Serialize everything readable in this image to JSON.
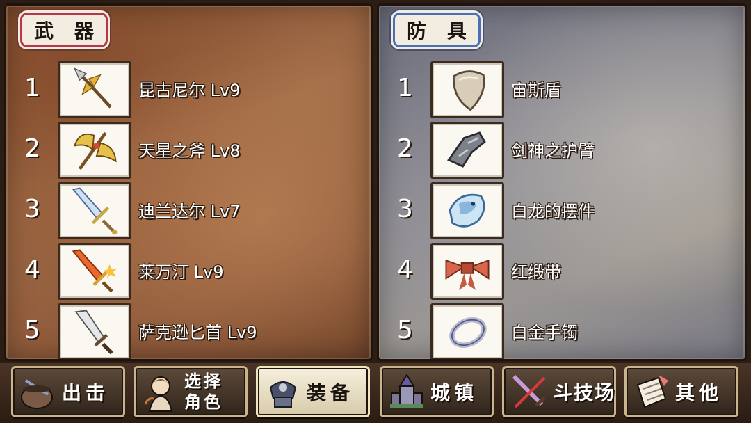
{
  "weapons_panel": {
    "title": "武 器",
    "items": [
      {
        "num": "1",
        "name": "昆古尼尔 Lv9",
        "icon": "spear-icon"
      },
      {
        "num": "2",
        "name": "天星之斧 Lv8",
        "icon": "axe-icon"
      },
      {
        "num": "3",
        "name": "迪兰达尔 Lv7",
        "icon": "sword-icon"
      },
      {
        "num": "4",
        "name": "莱万汀 Lv9",
        "icon": "flame-sword-icon"
      },
      {
        "num": "5",
        "name": "萨克逊匕首 Lv9",
        "icon": "dagger-icon"
      }
    ]
  },
  "armor_panel": {
    "title": "防 具",
    "items": [
      {
        "num": "1",
        "name": "宙斯盾",
        "icon": "shield-icon"
      },
      {
        "num": "2",
        "name": "剑神之护臂",
        "icon": "gauntlet-icon"
      },
      {
        "num": "3",
        "name": "白龙的摆件",
        "icon": "dragon-ornament-icon"
      },
      {
        "num": "4",
        "name": "红缎带",
        "icon": "ribbon-icon"
      },
      {
        "num": "5",
        "name": "白金手镯",
        "icon": "bracelet-icon"
      }
    ]
  },
  "navbar": {
    "items": [
      {
        "label": "出击",
        "icon": "cauldron-icon",
        "active": false
      },
      {
        "label_line1": "选择",
        "label_line2": "角色",
        "icon": "character-icon",
        "active": false
      },
      {
        "label": "装备",
        "icon": "armor-icon",
        "active": true
      },
      {
        "label": "城镇",
        "icon": "town-icon",
        "active": false
      },
      {
        "label": "斗技场",
        "icon": "crossed-swords-icon",
        "active": false
      },
      {
        "label": "其他",
        "icon": "scroll-icon",
        "active": false
      }
    ]
  },
  "colors": {
    "weapons_title_border": "#b8364a",
    "armor_title_border": "#4a6fb8",
    "active_nav_bg": "#f6efdc"
  }
}
